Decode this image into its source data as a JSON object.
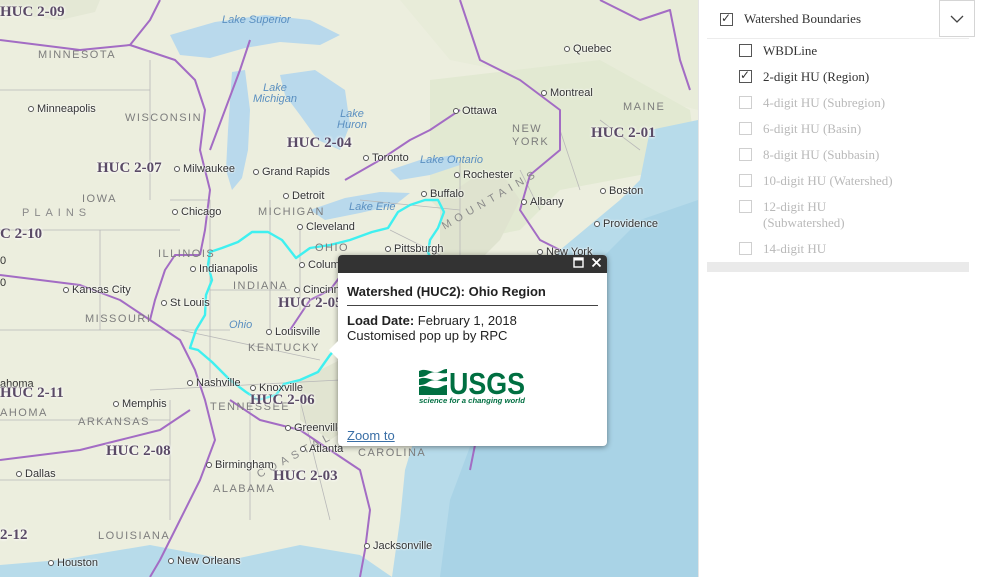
{
  "map": {
    "huc_labels": [
      {
        "id": "huc-2-09",
        "text": "HUC 2-09"
      },
      {
        "id": "huc-2-04",
        "text": "HUC 2-04"
      },
      {
        "id": "huc-2-07",
        "text": "HUC 2-07"
      },
      {
        "id": "huc-2-10",
        "text": "C 2-10"
      },
      {
        "id": "huc-2-01",
        "text": "HUC 2-01"
      },
      {
        "id": "huc-2-05",
        "text": "HUC 2-05"
      },
      {
        "id": "huc-2-11",
        "text": "HUC 2-11"
      },
      {
        "id": "huc-2-06",
        "text": "HUC 2-06"
      },
      {
        "id": "huc-2-08",
        "text": "HUC 2-08"
      },
      {
        "id": "huc-2-03",
        "text": "HUC 2-03"
      },
      {
        "id": "huc-2-12",
        "text": "2-12"
      }
    ],
    "cities": [
      "Minneapolis",
      "Milwaukee",
      "Grand Rapids",
      "Detroit",
      "Chicago",
      "Cleveland",
      "Toronto",
      "Rochester",
      "Buffalo",
      "Ottawa",
      "Montreal",
      "Quebec",
      "Boston",
      "Albany",
      "Providence",
      "New York",
      "Pittsburgh",
      "Columbus",
      "Indianapolis",
      "Cincinnati",
      "Louisville",
      "St Louis",
      "Kansas City",
      "Nashville",
      "Knoxville",
      "Memphis",
      "Greenville",
      "Atlanta",
      "Birmingham",
      "Dallas",
      "Houston",
      "New Orleans",
      "Jacksonville"
    ],
    "states": [
      "MINNESOTA",
      "WISCONSIN",
      "MICHIGAN",
      "IOWA",
      "ILLINOIS",
      "INDIANA",
      "OHIO",
      "MISSOURI",
      "KENTUCKY",
      "TENNESSEE",
      "ARKANSAS",
      "ALABAMA",
      "LOUISIANA",
      "NEW YORK",
      "MAINE",
      "CAROLINA",
      "AHOMA"
    ],
    "water": [
      "Lake Superior",
      "Lake Michigan",
      "Lake Huron",
      "Lake Ontario",
      "Lake Erie",
      "Ohio"
    ],
    "physio": [
      "PLAINS",
      "COASTAL PLAIN",
      "MOUNTAINS"
    ],
    "partial": [
      "ahoma",
      "0",
      "0"
    ]
  },
  "popup": {
    "title": "Watershed (HUC2): Ohio Region",
    "load_date_label": "Load Date:",
    "load_date_value": "February 1, 2018",
    "custom_text": "Customised pop up by RPC",
    "logo_text": "USGS",
    "logo_tagline": "science for a changing world",
    "zoom_link": "Zoom to",
    "maximize_icon": "maximize-icon",
    "close_icon": "close-icon",
    "colors": {
      "titlebar": "#333333",
      "link": "#3a6fa6",
      "usgs": "#006f41"
    }
  },
  "layer_list": {
    "group": {
      "label": "Watershed Boundaries",
      "checked": true
    },
    "expand_icon": "chevron-down-icon",
    "layers": [
      {
        "label": "WBDLine",
        "checked": false,
        "enabled": true
      },
      {
        "label": "2-digit HU (Region)",
        "checked": true,
        "enabled": true
      },
      {
        "label": "4-digit HU (Subregion)",
        "checked": false,
        "enabled": false
      },
      {
        "label": "6-digit HU (Basin)",
        "checked": false,
        "enabled": false
      },
      {
        "label": "8-digit HU (Subbasin)",
        "checked": false,
        "enabled": false
      },
      {
        "label": "10-digit HU (Watershed)",
        "checked": false,
        "enabled": false
      },
      {
        "label": "12-digit HU (Subwatershed)",
        "checked": false,
        "enabled": false
      },
      {
        "label": "14-digit HU",
        "checked": false,
        "enabled": false
      }
    ]
  }
}
